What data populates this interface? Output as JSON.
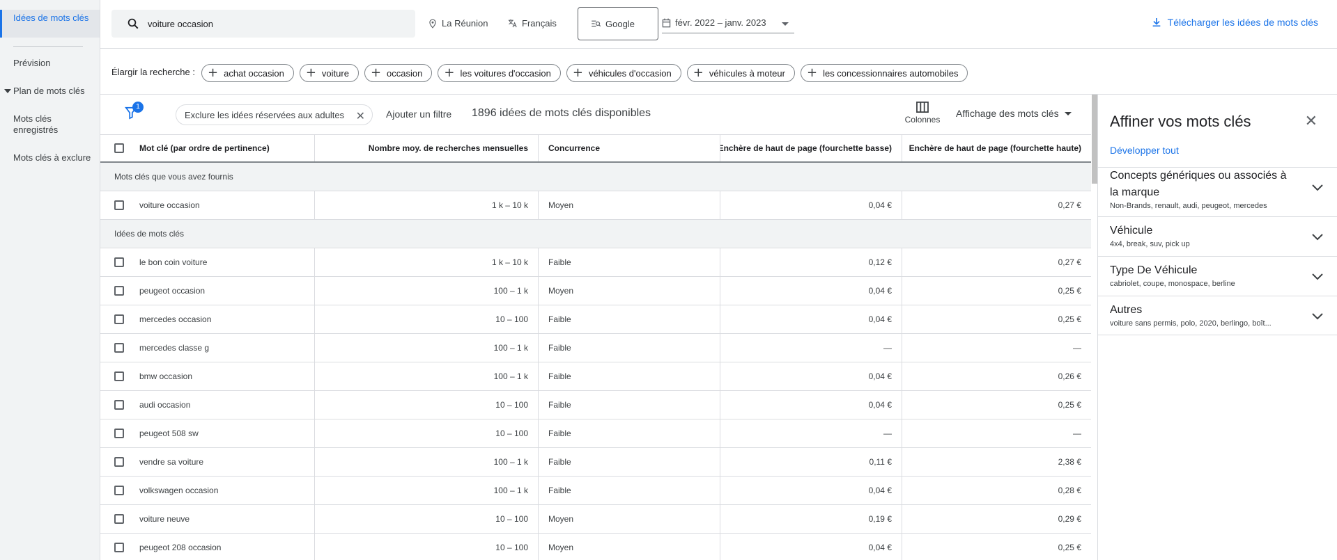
{
  "sidebar": {
    "items": [
      {
        "label": "Idées de mots clés"
      },
      {
        "label": "Prévision"
      },
      {
        "label": "Plan de mots clés"
      },
      {
        "label": "Mots clés enregistrés"
      },
      {
        "label": "Mots clés à exclure"
      }
    ]
  },
  "topbar": {
    "search_value": "voiture occasion",
    "location": "La Réunion",
    "language": "Français",
    "network": "Google",
    "date_range": "févr. 2022 – janv. 2023",
    "download_label": "Télécharger les idées de mots clés"
  },
  "broaden": {
    "label": "Élargir la recherche :",
    "chips": [
      "achat occasion",
      "voiture",
      "occasion",
      "les voitures d'occasion",
      "véhicules d'occasion",
      "véhicules à moteur",
      "les concessionnaires automobiles"
    ]
  },
  "filterbar": {
    "filter_count": "1",
    "filter_chip": "Exclure les idées réservées aux adultes",
    "add_filter": "Ajouter un filtre",
    "count_text": "1896 idées de mots clés disponibles",
    "columns_label": "Colonnes",
    "view_label": "Affichage des mots clés"
  },
  "table": {
    "headers": [
      "Mot clé (par ordre de pertinence)",
      "Nombre moy. de recherches mensuelles",
      "Concurrence",
      "Enchère de haut de page (fourchette basse)",
      "Enchère de haut de page (fourchette haute)"
    ],
    "section_provided": "Mots clés que vous avez fournis",
    "provided": [
      {
        "keyword": "voiture occasion",
        "searches": "1 k – 10 k",
        "competition": "Moyen",
        "low": "0,04 €",
        "high": "0,27 €"
      }
    ],
    "section_ideas": "Idées de mots clés",
    "ideas": [
      {
        "keyword": "le bon coin voiture",
        "searches": "1 k – 10 k",
        "competition": "Faible",
        "low": "0,12 €",
        "high": "0,27 €"
      },
      {
        "keyword": "peugeot occasion",
        "searches": "100 – 1 k",
        "competition": "Moyen",
        "low": "0,04 €",
        "high": "0,25 €"
      },
      {
        "keyword": "mercedes occasion",
        "searches": "10 – 100",
        "competition": "Faible",
        "low": "0,04 €",
        "high": "0,25 €"
      },
      {
        "keyword": "mercedes classe g",
        "searches": "100 – 1 k",
        "competition": "Faible",
        "low": "—",
        "high": "—"
      },
      {
        "keyword": "bmw occasion",
        "searches": "100 – 1 k",
        "competition": "Faible",
        "low": "0,04 €",
        "high": "0,26 €"
      },
      {
        "keyword": "audi occasion",
        "searches": "10 – 100",
        "competition": "Faible",
        "low": "0,04 €",
        "high": "0,25 €"
      },
      {
        "keyword": "peugeot 508 sw",
        "searches": "10 – 100",
        "competition": "Faible",
        "low": "—",
        "high": "—"
      },
      {
        "keyword": "vendre sa voiture",
        "searches": "100 – 1 k",
        "competition": "Faible",
        "low": "0,11 €",
        "high": "2,38 €"
      },
      {
        "keyword": "volkswagen occasion",
        "searches": "100 – 1 k",
        "competition": "Faible",
        "low": "0,04 €",
        "high": "0,28 €"
      },
      {
        "keyword": "voiture neuve",
        "searches": "10 – 100",
        "competition": "Moyen",
        "low": "0,19 €",
        "high": "0,29 €"
      },
      {
        "keyword": "peugeot 208 occasion",
        "searches": "10 – 100",
        "competition": "Moyen",
        "low": "0,04 €",
        "high": "0,25 €"
      }
    ]
  },
  "panel": {
    "title": "Affiner vos mots clés",
    "expand_all": "Développer tout",
    "groups": [
      {
        "title": "Concepts génériques ou associés à la marque",
        "subtitle": "Non-Brands, renault, audi, peugeot, mercedes"
      },
      {
        "title": "Véhicule",
        "subtitle": "4x4, break, suv, pick up"
      },
      {
        "title": "Type De Véhicule",
        "subtitle": "cabriolet, coupe, monospace, berline"
      },
      {
        "title": "Autres",
        "subtitle": "voiture sans permis, polo, 2020, berlingo, boît..."
      }
    ]
  },
  "colors": {
    "accent": "#1a73e8",
    "sidebar_bg": "#f1f3f4"
  }
}
